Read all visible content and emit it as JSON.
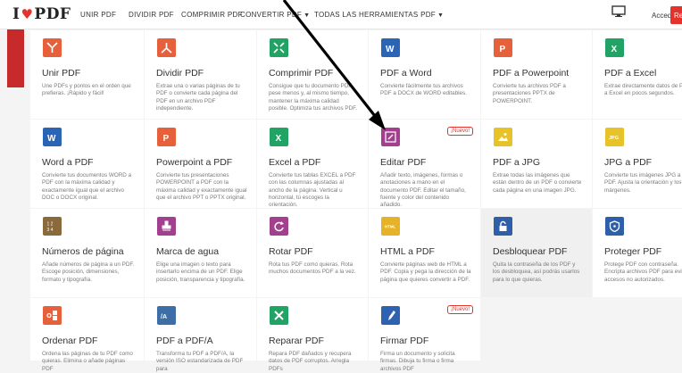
{
  "header": {
    "logo_left": "I",
    "logo_right": "PDF",
    "nav": [
      {
        "label": "UNIR PDF",
        "dropdown": false
      },
      {
        "label": "DIVIDIR PDF",
        "dropdown": false
      },
      {
        "label": "COMPRIMIR PDF",
        "dropdown": false
      },
      {
        "label": "CONVERTIR PDF",
        "dropdown": true
      },
      {
        "label": "TODAS LAS HERRAMIENTAS PDF",
        "dropdown": true
      }
    ],
    "login": "Acceder",
    "register": "Re"
  },
  "colors": {
    "brand_red": "#e5322d",
    "word_blue": "#2b64b5",
    "powerpoint_orange": "#e7603c",
    "excel_green": "#21a366",
    "edit_purple": "#a23f8e",
    "jpg_yellow": "#e8c229",
    "number_brown": "#8a6a3b",
    "html_yellow": "#e5b228",
    "lock_blue": "#2f5fa8",
    "pdfa_blue": "#3d6ea6",
    "firmar_blue": "#2e62b0"
  },
  "badge_new": "¡Nuevo!",
  "tools": [
    {
      "title": "Unir PDF",
      "desc": "Une PDFs y ponlos en el orden que prefieras. ¡Rápido y fácil!",
      "icon": "merge-icon",
      "color": "#e7603c",
      "new": false
    },
    {
      "title": "Dividir PDF",
      "desc": "Extrae una o varias páginas de tu PDF o convierte cada página del PDF en un archivo PDF independiente.",
      "icon": "split-icon",
      "color": "#e7603c",
      "new": false
    },
    {
      "title": "Comprimir PDF",
      "desc": "Consigue que tu documento PDF pese menos y, al mismo tiempo, mantener la máxima calidad posible. Optimiza tus archivos PDF.",
      "icon": "compress-icon",
      "color": "#21a366",
      "new": false
    },
    {
      "title": "PDF a Word",
      "desc": "Convierte fácilmente tus archivos PDF a DOCX de WORD editables.",
      "icon": "word-icon",
      "color": "#2b64b5",
      "new": false
    },
    {
      "title": "PDF a Powerpoint",
      "desc": "Convierte tus archivos PDF a presentaciones PPTX de POWERPOINT.",
      "icon": "powerpoint-icon",
      "color": "#e7603c",
      "new": false
    },
    {
      "title": "PDF a Excel",
      "desc": "Extrae directamente datos de PDF a Excel en pocos segundos.",
      "icon": "excel-icon",
      "color": "#21a366",
      "new": false
    },
    {
      "title": "Word a PDF",
      "desc": "Convierte tus documentos WORD a PDF con la máxima calidad y exactamente igual que el archivo DOC o DOCX original.",
      "icon": "word-icon",
      "color": "#2b64b5",
      "new": false
    },
    {
      "title": "Powerpoint a PDF",
      "desc": "Convierte tus presentaciones POWERPOINT a PDF con la máxima calidad y exactamente igual que el archivo PPT o PPTX original.",
      "icon": "powerpoint-icon",
      "color": "#e7603c",
      "new": false
    },
    {
      "title": "Excel a PDF",
      "desc": "Convierte tus tablas EXCEL a PDF con las columnas ajustadas al ancho de la página. Vertical u horizontal, tú escoges la orientación.",
      "icon": "excel-icon",
      "color": "#21a366",
      "new": false
    },
    {
      "title": "Editar PDF",
      "desc": "Añadir texto, imágenes, formas o anotaciones a mano en el documento PDF. Editar el tamaño, fuente y color del contenido añadido.",
      "icon": "edit-icon",
      "color": "#a23f8e",
      "new": true
    },
    {
      "title": "PDF a JPG",
      "desc": "Extrae todas las imágenes que están dentro de un PDF o convierte cada página en una imagen JPG.",
      "icon": "image-icon",
      "color": "#e8c229",
      "new": false
    },
    {
      "title": "JPG a PDF",
      "desc": "Convierte tus imágenes JPG a PDF. Ajusta la orientación y los márgenes.",
      "icon": "jpg-icon",
      "color": "#e8c229",
      "new": false
    },
    {
      "title": "Números de página",
      "desc": "Añade números de página a un PDF. Escoge posición, dimensiones, formato y tipografía.",
      "icon": "page-numbers-icon",
      "color": "#8a6a3b",
      "new": false
    },
    {
      "title": "Marca de agua",
      "desc": "Elige una imagen o texto para insertarlo encima de un PDF. Elige posición, transparencia y tipografía.",
      "icon": "stamp-icon",
      "color": "#a23f8e",
      "new": false
    },
    {
      "title": "Rotar PDF",
      "desc": "Rota tus PDF como quieras. Rota muchos documentos PDF a la vez.",
      "icon": "rotate-icon",
      "color": "#a23f8e",
      "new": false
    },
    {
      "title": "HTML a PDF",
      "desc": "Convierte páginas web de HTML a PDF. Copia y pega la dirección de la página que quieres convertir a PDF.",
      "icon": "html-icon",
      "color": "#e5b228",
      "new": false
    },
    {
      "title": "Desbloquear PDF",
      "desc": "Quita la contraseña de los PDF y los desbloquea, así podrás usarlos para lo que quieras.",
      "icon": "unlock-icon",
      "color": "#2f5fa8",
      "new": false
    },
    {
      "title": "Proteger PDF",
      "desc": "Protege PDF con contraseña. Encripta archivos PDF para evitar accesos no autorizados.",
      "icon": "shield-icon",
      "color": "#2f5fa8",
      "new": false
    },
    {
      "title": "Ordenar PDF",
      "desc": "Ordena las páginas de tu PDF como quieras. Elimina o añade páginas PDF",
      "icon": "organize-icon",
      "color": "#e7603c",
      "new": false
    },
    {
      "title": "PDF a PDF/A",
      "desc": "Transforma tu PDF a PDF/A, la versión ISO estandarizada de PDF para",
      "icon": "pdfa-icon",
      "color": "#3d6ea6",
      "new": false
    },
    {
      "title": "Reparar PDF",
      "desc": "Repara PDF dañados y recupera datos de PDF corruptos. Arregla PDFs",
      "icon": "repair-icon",
      "color": "#21a366",
      "new": false
    },
    {
      "title": "Firmar PDF",
      "desc": "Firma un documento y solicita firmas. Dibuja tu firma o firma archivos PDF",
      "icon": "sign-icon",
      "color": "#2e62b0",
      "new": true
    }
  ]
}
